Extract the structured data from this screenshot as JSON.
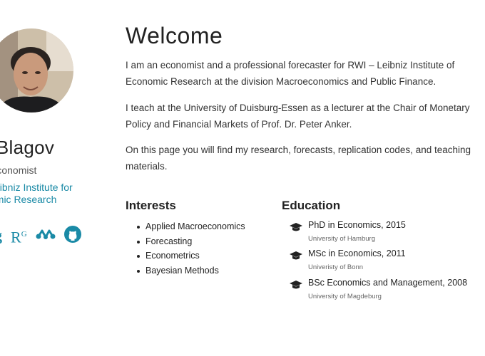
{
  "profile": {
    "name": "is Blagov",
    "role": "Economist",
    "affiliation_line1": "eibniz Institute for",
    "affiliation_line2": "omic Research",
    "social_icons": [
      "google-scholar-icon",
      "researchgate-icon",
      "mendeley-icon",
      "github-icon"
    ],
    "social_g": "g",
    "social_rg": "R",
    "social_rg_sup": "G"
  },
  "main": {
    "title": "Welcome",
    "bio": [
      "I am an economist and a professional forecaster for RWI – Leibniz Institute of Economic Research at the division Macroeconomics and Public Finance.",
      "I teach at the University of Duisburg-Essen as a lecturer at the Chair of Monetary Policy and Financial Markets of Prof. Dr. Peter Anker.",
      "On this page you will find my research, forecasts, replication codes, and teaching materials."
    ]
  },
  "interests": {
    "heading": "Interests",
    "items": [
      "Applied Macroeconomics",
      "Forecasting",
      "Econometrics",
      "Bayesian Methods"
    ]
  },
  "education": {
    "heading": "Education",
    "items": [
      {
        "degree": "PhD in Economics, 2015",
        "institution": "University of Hamburg"
      },
      {
        "degree": "MSc in Economics, 2011",
        "institution": "Univeristy of Bonn"
      },
      {
        "degree": "BSc Economics and Management, 2008",
        "institution": "University of Magdeburg"
      }
    ]
  },
  "colors": {
    "accent": "#1a8aa6",
    "text": "#222222"
  }
}
